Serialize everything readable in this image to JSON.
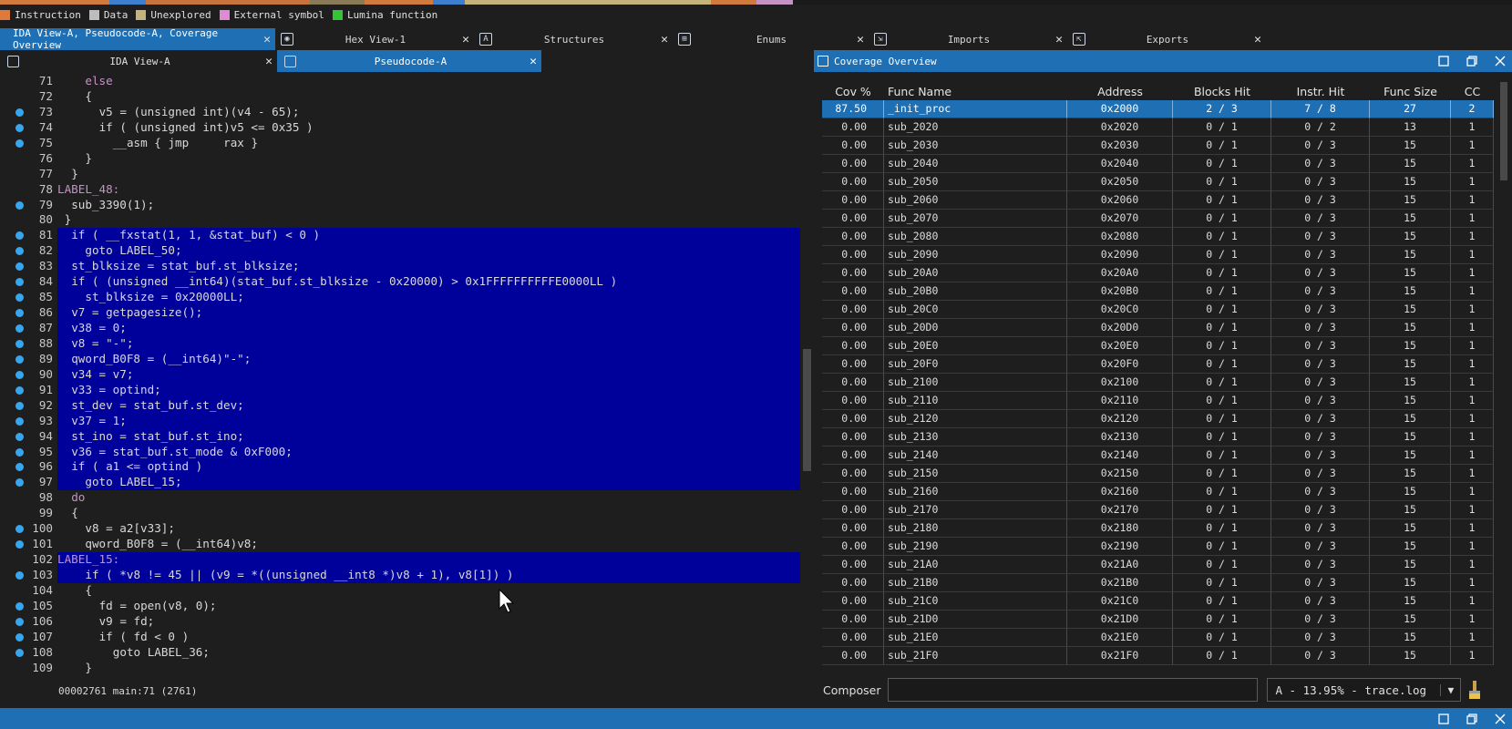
{
  "legend": [
    {
      "label": "Instruction",
      "color": "#e07a3c"
    },
    {
      "label": "Data",
      "color": "#bdbdbd"
    },
    {
      "label": "Unexplored",
      "color": "#c4b37a"
    },
    {
      "label": "External symbol",
      "color": "#e08ad6"
    },
    {
      "label": "Lumina function",
      "color": "#34c534"
    }
  ],
  "tabs": [
    {
      "label": "IDA View-A, Pseudocode-A, Coverage Overview",
      "active": true,
      "icon": "ida-view-icon"
    },
    {
      "label": "Hex View-1",
      "active": false,
      "icon": "hex-view-icon"
    },
    {
      "label": "Structures",
      "active": false,
      "icon": "structures-icon"
    },
    {
      "label": "Enums",
      "active": false,
      "icon": "enums-icon"
    },
    {
      "label": "Imports",
      "active": false,
      "icon": "imports-icon"
    },
    {
      "label": "Exports",
      "active": false,
      "icon": "exports-icon"
    }
  ],
  "subtabs": [
    {
      "label": "IDA View-A",
      "active": false
    },
    {
      "label": "Pseudocode-A",
      "active": true
    }
  ],
  "code_lines": [
    {
      "n": "71",
      "indent": 2,
      "text": "else",
      "dot": false,
      "sel": false,
      "kind": "kw"
    },
    {
      "n": "72",
      "indent": 2,
      "text": "{",
      "dot": false,
      "sel": false,
      "kind": ""
    },
    {
      "n": "73",
      "indent": 3,
      "text": "v5 = (unsigned int)(v4 - 65);",
      "dot": true,
      "sel": false,
      "kind": ""
    },
    {
      "n": "74",
      "indent": 3,
      "text": "if ( (unsigned int)v5 <= 0x35 )",
      "dot": true,
      "sel": false,
      "kind": ""
    },
    {
      "n": "75",
      "indent": 4,
      "text": "__asm { jmp     rax }",
      "dot": true,
      "sel": false,
      "kind": ""
    },
    {
      "n": "76",
      "indent": 2,
      "text": "}",
      "dot": false,
      "sel": false,
      "kind": ""
    },
    {
      "n": "77",
      "indent": 1,
      "text": "}",
      "dot": false,
      "sel": false,
      "kind": ""
    },
    {
      "n": "78",
      "indent": 0,
      "text": "LABEL_48:",
      "dot": false,
      "sel": false,
      "kind": "label"
    },
    {
      "n": "79",
      "indent": 1,
      "text": "sub_3390(1);",
      "dot": true,
      "sel": false,
      "kind": ""
    },
    {
      "n": "80",
      "indent": 0.5,
      "text": "}",
      "dot": false,
      "sel": false,
      "kind": ""
    },
    {
      "n": "81",
      "indent": 1,
      "text": "if ( __fxstat(1, 1, &stat_buf) < 0 )",
      "dot": true,
      "sel": true,
      "kind": ""
    },
    {
      "n": "82",
      "indent": 2,
      "text": "goto LABEL_50;",
      "dot": true,
      "sel": true,
      "kind": ""
    },
    {
      "n": "83",
      "indent": 1,
      "text": "st_blksize = stat_buf.st_blksize;",
      "dot": true,
      "sel": true,
      "kind": ""
    },
    {
      "n": "84",
      "indent": 1,
      "text": "if ( (unsigned __int64)(stat_buf.st_blksize - 0x20000) > 0x1FFFFFFFFFFE0000LL )",
      "dot": true,
      "sel": true,
      "kind": ""
    },
    {
      "n": "85",
      "indent": 2,
      "text": "st_blksize = 0x20000LL;",
      "dot": true,
      "sel": true,
      "kind": ""
    },
    {
      "n": "86",
      "indent": 1,
      "text": "v7 = getpagesize();",
      "dot": true,
      "sel": true,
      "kind": ""
    },
    {
      "n": "87",
      "indent": 1,
      "text": "v38 = 0;",
      "dot": true,
      "sel": true,
      "kind": ""
    },
    {
      "n": "88",
      "indent": 1,
      "text": "v8 = \"-\";",
      "dot": true,
      "sel": true,
      "kind": ""
    },
    {
      "n": "89",
      "indent": 1,
      "text": "qword_B0F8 = (__int64)\"-\";",
      "dot": true,
      "sel": true,
      "kind": ""
    },
    {
      "n": "90",
      "indent": 1,
      "text": "v34 = v7;",
      "dot": true,
      "sel": true,
      "kind": ""
    },
    {
      "n": "91",
      "indent": 1,
      "text": "v33 = optind;",
      "dot": true,
      "sel": true,
      "kind": ""
    },
    {
      "n": "92",
      "indent": 1,
      "text": "st_dev = stat_buf.st_dev;",
      "dot": true,
      "sel": true,
      "kind": ""
    },
    {
      "n": "93",
      "indent": 1,
      "text": "v37 = 1;",
      "dot": true,
      "sel": true,
      "kind": ""
    },
    {
      "n": "94",
      "indent": 1,
      "text": "st_ino = stat_buf.st_ino;",
      "dot": true,
      "sel": true,
      "kind": ""
    },
    {
      "n": "95",
      "indent": 1,
      "text": "v36 = stat_buf.st_mode & 0xF000;",
      "dot": true,
      "sel": true,
      "kind": ""
    },
    {
      "n": "96",
      "indent": 1,
      "text": "if ( a1 <= optind )",
      "dot": true,
      "sel": true,
      "kind": ""
    },
    {
      "n": "97",
      "indent": 2,
      "text": "goto LABEL_15;",
      "dot": true,
      "sel": true,
      "kind": ""
    },
    {
      "n": "98",
      "indent": 1,
      "text": "do",
      "dot": false,
      "sel": false,
      "kind": "kw"
    },
    {
      "n": "99",
      "indent": 1,
      "text": "{",
      "dot": false,
      "sel": false,
      "kind": ""
    },
    {
      "n": "100",
      "indent": 2,
      "text": "v8 = a2[v33];",
      "dot": true,
      "sel": false,
      "kind": ""
    },
    {
      "n": "101",
      "indent": 2,
      "text": "qword_B0F8 = (__int64)v8;",
      "dot": true,
      "sel": false,
      "kind": ""
    },
    {
      "n": "102",
      "indent": 0,
      "text": "LABEL_15:",
      "dot": false,
      "sel": true,
      "kind": "label"
    },
    {
      "n": "103",
      "indent": 2,
      "text": "if ( *v8 != 45 || (v9 = *((unsigned __int8 *)v8 + 1), v8[1]) )",
      "dot": true,
      "sel": true,
      "kind": ""
    },
    {
      "n": "104",
      "indent": 2,
      "text": "{",
      "dot": false,
      "sel": false,
      "kind": ""
    },
    {
      "n": "105",
      "indent": 3,
      "text": "fd = open(v8, 0);",
      "dot": true,
      "sel": false,
      "kind": ""
    },
    {
      "n": "106",
      "indent": 3,
      "text": "v9 = fd;",
      "dot": true,
      "sel": false,
      "kind": ""
    },
    {
      "n": "107",
      "indent": 3,
      "text": "if ( fd < 0 )",
      "dot": true,
      "sel": false,
      "kind": ""
    },
    {
      "n": "108",
      "indent": 4,
      "text": "goto LABEL_36;",
      "dot": true,
      "sel": false,
      "kind": ""
    },
    {
      "n": "109",
      "indent": 2,
      "text": "}",
      "dot": false,
      "sel": false,
      "kind": ""
    }
  ],
  "code_status": "00002761 main:71 (2761)",
  "coverage": {
    "title": "Coverage Overview",
    "columns": [
      "Cov %",
      "Func Name",
      "Address",
      "Blocks Hit",
      "Instr. Hit",
      "Func Size",
      "CC"
    ],
    "rows": [
      [
        "87.50",
        "_init_proc",
        "0x2000",
        "2 / 3",
        "7 / 8",
        "27",
        "2"
      ],
      [
        "0.00",
        "sub_2020",
        "0x2020",
        "0 / 1",
        "0 / 2",
        "13",
        "1"
      ],
      [
        "0.00",
        "sub_2030",
        "0x2030",
        "0 / 1",
        "0 / 3",
        "15",
        "1"
      ],
      [
        "0.00",
        "sub_2040",
        "0x2040",
        "0 / 1",
        "0 / 3",
        "15",
        "1"
      ],
      [
        "0.00",
        "sub_2050",
        "0x2050",
        "0 / 1",
        "0 / 3",
        "15",
        "1"
      ],
      [
        "0.00",
        "sub_2060",
        "0x2060",
        "0 / 1",
        "0 / 3",
        "15",
        "1"
      ],
      [
        "0.00",
        "sub_2070",
        "0x2070",
        "0 / 1",
        "0 / 3",
        "15",
        "1"
      ],
      [
        "0.00",
        "sub_2080",
        "0x2080",
        "0 / 1",
        "0 / 3",
        "15",
        "1"
      ],
      [
        "0.00",
        "sub_2090",
        "0x2090",
        "0 / 1",
        "0 / 3",
        "15",
        "1"
      ],
      [
        "0.00",
        "sub_20A0",
        "0x20A0",
        "0 / 1",
        "0 / 3",
        "15",
        "1"
      ],
      [
        "0.00",
        "sub_20B0",
        "0x20B0",
        "0 / 1",
        "0 / 3",
        "15",
        "1"
      ],
      [
        "0.00",
        "sub_20C0",
        "0x20C0",
        "0 / 1",
        "0 / 3",
        "15",
        "1"
      ],
      [
        "0.00",
        "sub_20D0",
        "0x20D0",
        "0 / 1",
        "0 / 3",
        "15",
        "1"
      ],
      [
        "0.00",
        "sub_20E0",
        "0x20E0",
        "0 / 1",
        "0 / 3",
        "15",
        "1"
      ],
      [
        "0.00",
        "sub_20F0",
        "0x20F0",
        "0 / 1",
        "0 / 3",
        "15",
        "1"
      ],
      [
        "0.00",
        "sub_2100",
        "0x2100",
        "0 / 1",
        "0 / 3",
        "15",
        "1"
      ],
      [
        "0.00",
        "sub_2110",
        "0x2110",
        "0 / 1",
        "0 / 3",
        "15",
        "1"
      ],
      [
        "0.00",
        "sub_2120",
        "0x2120",
        "0 / 1",
        "0 / 3",
        "15",
        "1"
      ],
      [
        "0.00",
        "sub_2130",
        "0x2130",
        "0 / 1",
        "0 / 3",
        "15",
        "1"
      ],
      [
        "0.00",
        "sub_2140",
        "0x2140",
        "0 / 1",
        "0 / 3",
        "15",
        "1"
      ],
      [
        "0.00",
        "sub_2150",
        "0x2150",
        "0 / 1",
        "0 / 3",
        "15",
        "1"
      ],
      [
        "0.00",
        "sub_2160",
        "0x2160",
        "0 / 1",
        "0 / 3",
        "15",
        "1"
      ],
      [
        "0.00",
        "sub_2170",
        "0x2170",
        "0 / 1",
        "0 / 3",
        "15",
        "1"
      ],
      [
        "0.00",
        "sub_2180",
        "0x2180",
        "0 / 1",
        "0 / 3",
        "15",
        "1"
      ],
      [
        "0.00",
        "sub_2190",
        "0x2190",
        "0 / 1",
        "0 / 3",
        "15",
        "1"
      ],
      [
        "0.00",
        "sub_21A0",
        "0x21A0",
        "0 / 1",
        "0 / 3",
        "15",
        "1"
      ],
      [
        "0.00",
        "sub_21B0",
        "0x21B0",
        "0 / 1",
        "0 / 3",
        "15",
        "1"
      ],
      [
        "0.00",
        "sub_21C0",
        "0x21C0",
        "0 / 1",
        "0 / 3",
        "15",
        "1"
      ],
      [
        "0.00",
        "sub_21D0",
        "0x21D0",
        "0 / 1",
        "0 / 3",
        "15",
        "1"
      ],
      [
        "0.00",
        "sub_21E0",
        "0x21E0",
        "0 / 1",
        "0 / 3",
        "15",
        "1"
      ],
      [
        "0.00",
        "sub_21F0",
        "0x21F0",
        "0 / 1",
        "0 / 3",
        "15",
        "1"
      ]
    ],
    "composer_label": "Composer",
    "composer_value": "",
    "trace_select": "A - 13.95% - trace.log"
  },
  "colors": {
    "accent": "#1e6fb3",
    "selection": "#00009b",
    "breakpoint_dot": "#36a6ef"
  }
}
